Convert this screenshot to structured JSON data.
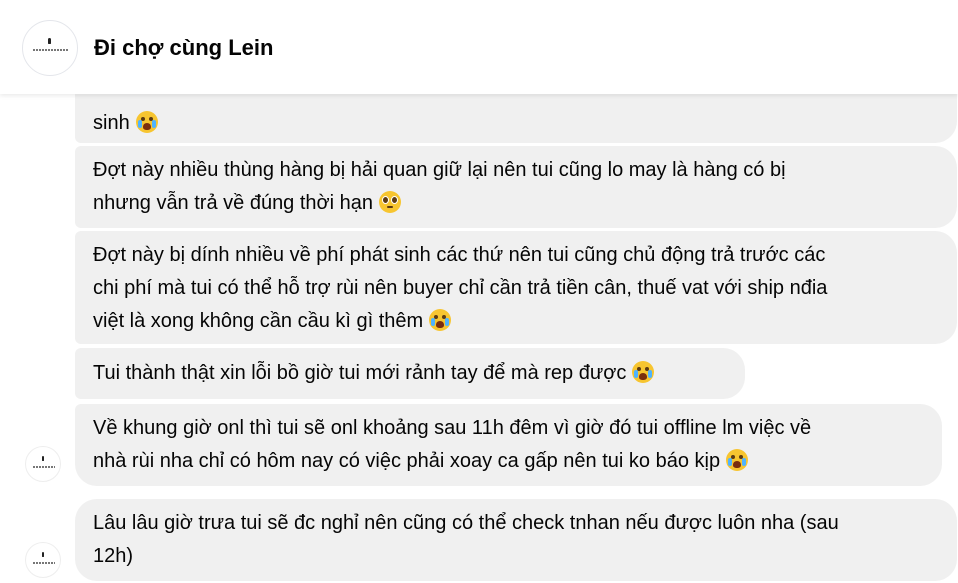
{
  "conversation": {
    "title": "Đi chợ cùng Lein",
    "avatar_icon": "shop-logo-icon"
  },
  "messages": [
    {
      "lines": [
        "",
        "sinh"
      ],
      "emoji": "loudly-crying-face-icon"
    },
    {
      "lines": [
        "Đợt này nhiều thùng hàng bị hải quan giữ lại nên tui cũng lo may là hàng có bị",
        "nhưng vẫn trả về đúng thời hạn"
      ],
      "emoji": "pleading-face-icon"
    },
    {
      "lines": [
        "Đợt này bị dính nhiều về phí phát sinh các thứ nên tui cũng chủ động trả trước các",
        "chi phí mà tui có thể hỗ trợ rùi nên buyer chỉ cần trả tiền cân, thuế vat với ship nđia",
        "việt là xong không cần cầu kì gì thêm"
      ],
      "emoji": "loudly-crying-face-icon"
    },
    {
      "lines": [
        "Tui thành thật xin lỗi bồ giờ tui mới rảnh tay để mà rep được"
      ],
      "emoji": "loudly-crying-face-icon"
    },
    {
      "lines": [
        "Về khung giờ onl thì tui sẽ onl khoảng sau 11h đêm vì giờ đó tui offline lm việc về",
        "nhà rùi nha chỉ có hôm nay có việc phải xoay ca gấp nên tui ko báo kịp"
      ],
      "emoji": "loudly-crying-face-icon"
    },
    {
      "lines": [
        "Lâu lâu giờ trưa tui sẽ đc nghỉ nên cũng có thể check tnhan nếu được luôn nha (sau",
        "12h)"
      ],
      "emoji": ""
    }
  ],
  "colors": {
    "bubble_background": "#f0f0f0",
    "text": "#050505",
    "header_background": "#ffffff"
  }
}
